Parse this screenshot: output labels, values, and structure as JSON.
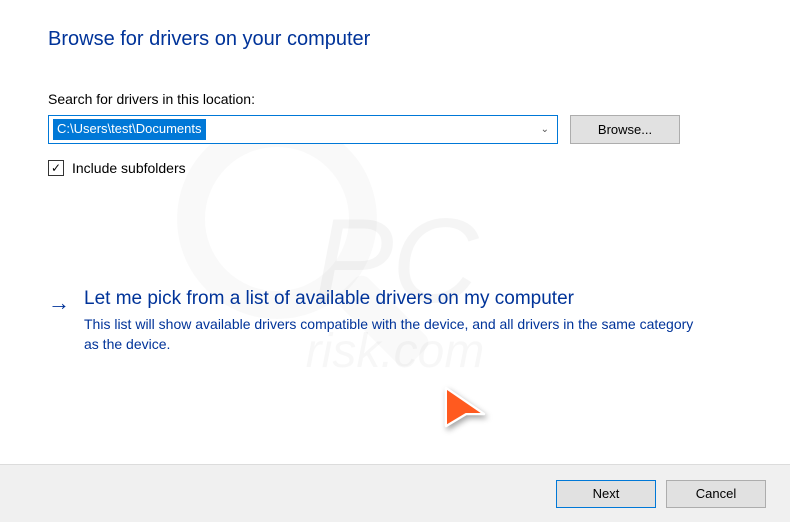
{
  "title": "Browse for drivers on your computer",
  "searchLabel": "Search for drivers in this location:",
  "pathValue": "C:\\Users\\test\\Documents",
  "browseLabel": "Browse...",
  "includeSubfolders": {
    "checked": true,
    "label": "Include subfolders",
    "mark": "✓"
  },
  "pickOption": {
    "title": "Let me pick from a list of available drivers on my computer",
    "description": "This list will show available drivers compatible with the device, and all drivers in the same category as the device."
  },
  "footer": {
    "next": "Next",
    "cancel": "Cancel"
  },
  "watermark": {
    "main": "PC",
    "sub": "risk.com"
  }
}
